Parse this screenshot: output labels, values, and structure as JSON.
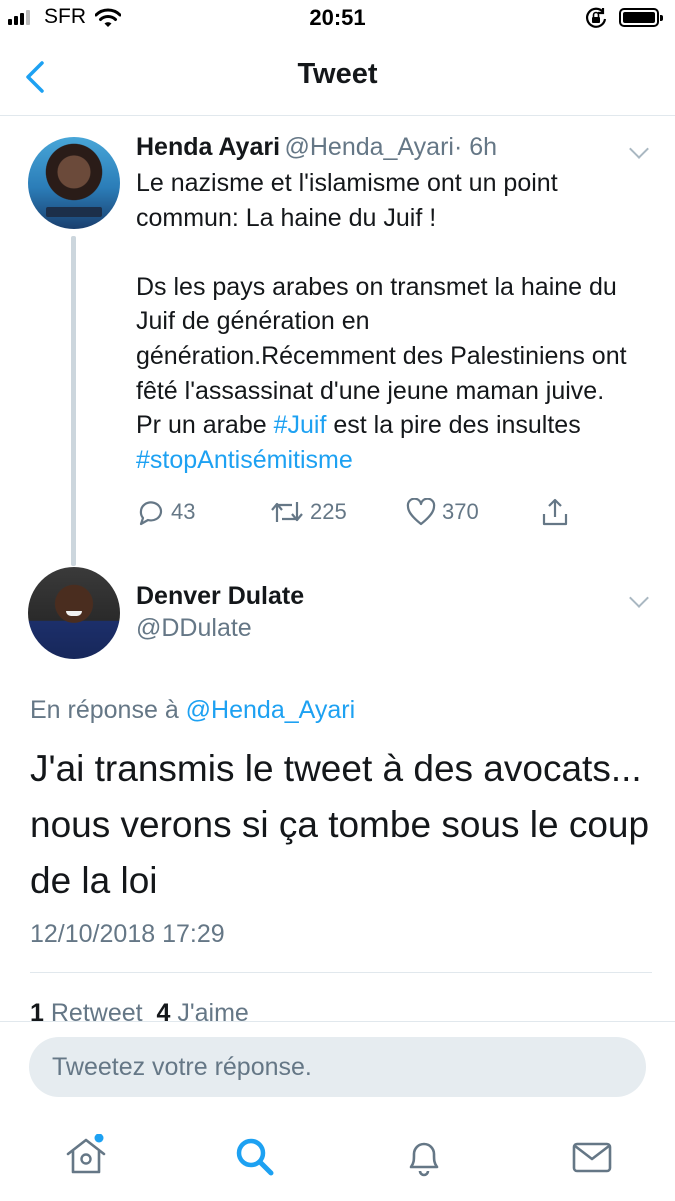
{
  "status_bar": {
    "carrier": "SFR",
    "time": "20:51"
  },
  "nav": {
    "back_icon": "chevron-left-icon",
    "title": "Tweet"
  },
  "original_tweet": {
    "author_name": "Henda Ayari",
    "author_handle": "@Henda_Ayari",
    "time_ago": "· 6h",
    "text_part1": "Le nazisme et l'islamisme ont un point commun: La haine du Juif !\n\nDs les pays arabes on transmet la haine du Juif de génération en génération.Récemment des Palestiniens ont fêté l'assassinat d'une jeune maman juive. Pr un arabe ",
    "hashtag1": "#Juif",
    "text_part2": " est la pire des insultes ",
    "hashtag2": "#stopAntisémitisme",
    "replies": "43",
    "retweets": "225",
    "likes": "370"
  },
  "reply_tweet": {
    "author_name": "Denver Dulate",
    "author_handle": "@DDulate",
    "reply_prefix": "En réponse à",
    "reply_to": "@Henda_Ayari",
    "text": "J'ai transmis le tweet à des avocats... nous verons si ça tombe sous le coup de la loi",
    "timestamp": "12/10/2018 17:29",
    "retweet_count": "1",
    "retweet_label": "Retweet",
    "like_count": "4",
    "like_label": "J'aime"
  },
  "composer": {
    "placeholder": "Tweetez votre réponse."
  },
  "tab_bar": [
    "home-icon",
    "search-icon",
    "notifications-icon",
    "messages-icon"
  ],
  "colors": {
    "accent": "#1da1f2",
    "muted": "#657786",
    "text": "#14171a"
  }
}
